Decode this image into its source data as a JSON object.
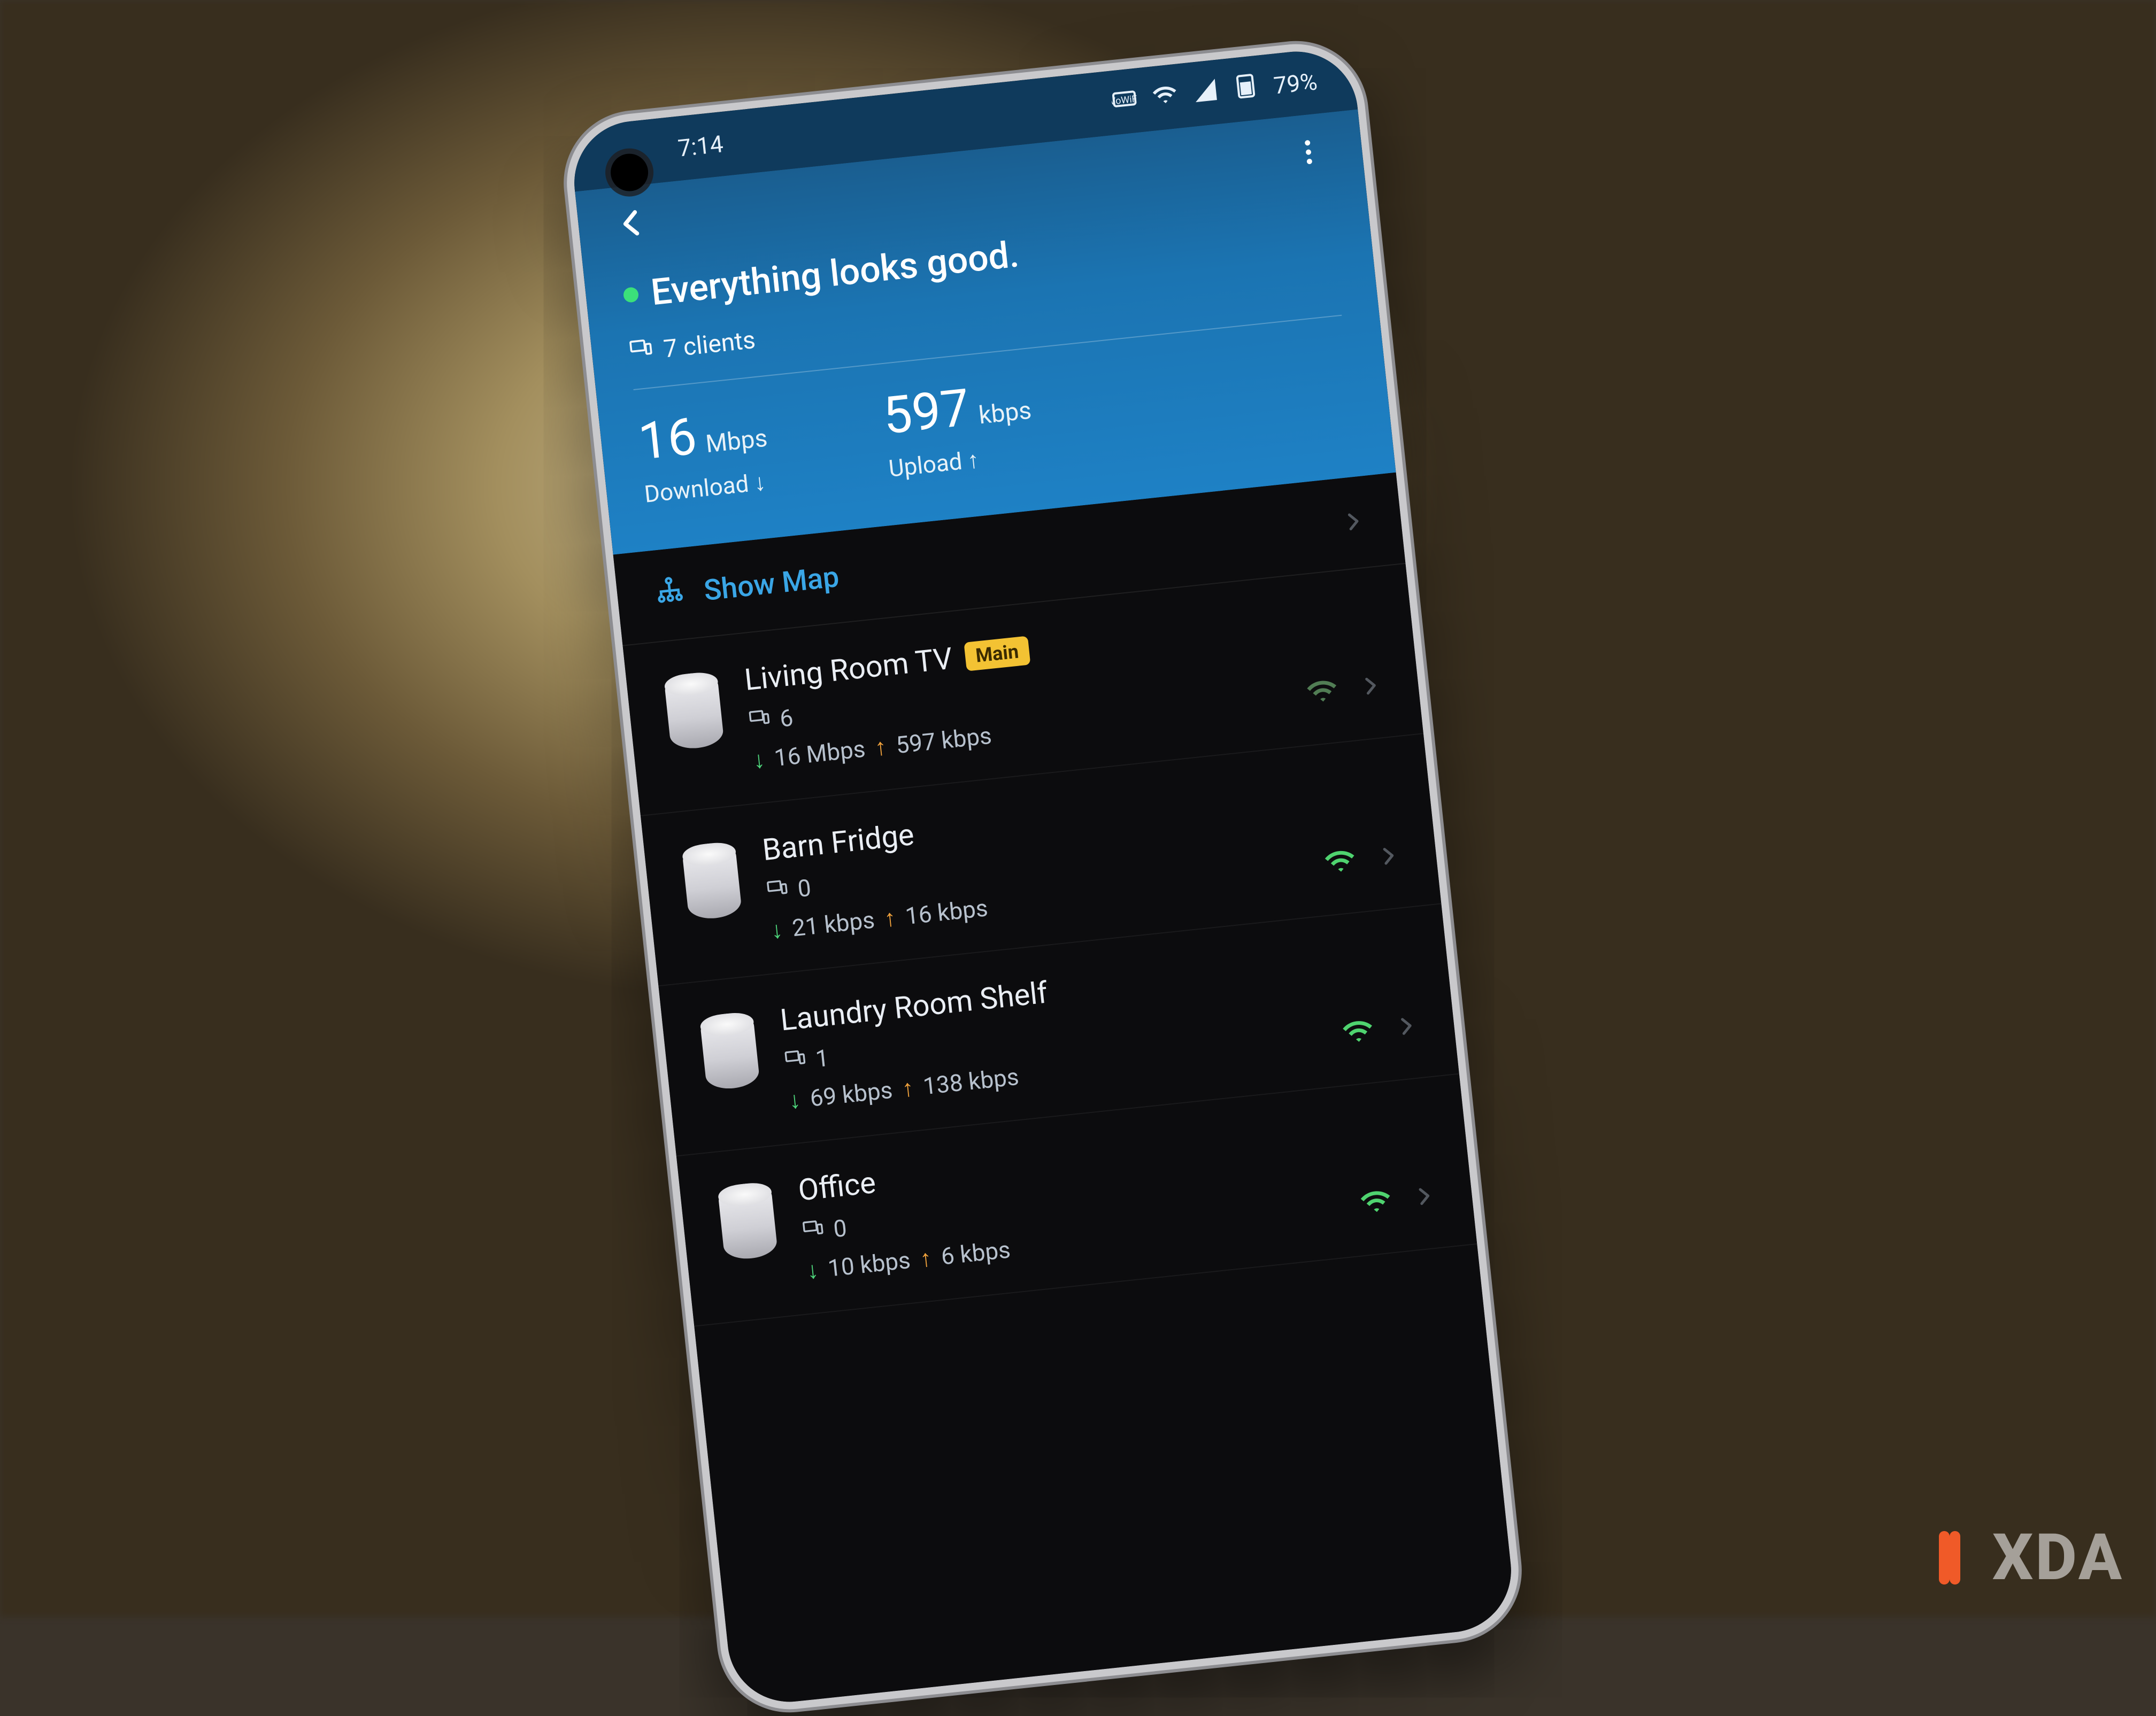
{
  "statusbar": {
    "time": "7:14",
    "battery": "79%"
  },
  "header": {
    "status_text": "Everything looks good.",
    "clients_count": "7 clients",
    "download_value": "16",
    "download_unit": "Mbps",
    "download_label": "Download",
    "upload_value": "597",
    "upload_unit": "kbps",
    "upload_label": "Upload"
  },
  "show_map_label": "Show Map",
  "main_badge": "Main",
  "nodes": [
    {
      "name": "Living Room TV",
      "is_main": true,
      "clients": "6",
      "down": "16 Mbps",
      "up": "597 kbps",
      "signal": "weak"
    },
    {
      "name": "Barn Fridge",
      "is_main": false,
      "clients": "0",
      "down": "21 kbps",
      "up": "16 kbps",
      "signal": "strong"
    },
    {
      "name": "Laundry Room Shelf",
      "is_main": false,
      "clients": "1",
      "down": "69 kbps",
      "up": "138 kbps",
      "signal": "strong"
    },
    {
      "name": "Office",
      "is_main": false,
      "clients": "0",
      "down": "10 kbps",
      "up": "6 kbps",
      "signal": "strong"
    }
  ],
  "watermark": "XDA"
}
